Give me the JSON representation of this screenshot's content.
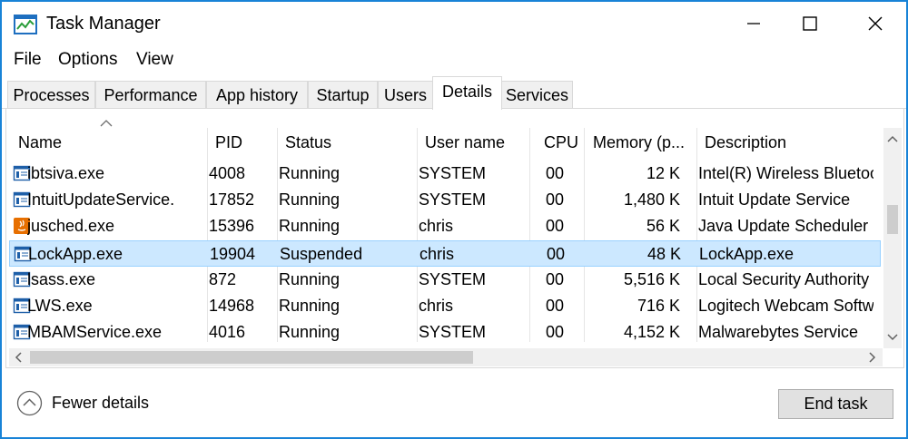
{
  "window": {
    "title": "Task Manager"
  },
  "menu": [
    "File",
    "Options",
    "View"
  ],
  "tabs": [
    {
      "label": "Processes",
      "active": false
    },
    {
      "label": "Performance",
      "active": false
    },
    {
      "label": "App history",
      "active": false
    },
    {
      "label": "Startup",
      "active": false
    },
    {
      "label": "Users",
      "active": false
    },
    {
      "label": "Details",
      "active": true
    },
    {
      "label": "Services",
      "active": false
    }
  ],
  "columns": [
    "Name",
    "PID",
    "Status",
    "User name",
    "CPU",
    "Memory (p...",
    "Description"
  ],
  "rows": [
    {
      "icon": "generic-app-icon",
      "name": "ibtsiva.exe",
      "pid": "4008",
      "status": "Running",
      "user": "SYSTEM",
      "cpu": "00",
      "memory": "12 K",
      "description": "Intel(R) Wireless Bluetoo",
      "selected": false
    },
    {
      "icon": "generic-app-icon",
      "name": "IntuitUpdateService.",
      "pid": "17852",
      "status": "Running",
      "user": "SYSTEM",
      "cpu": "00",
      "memory": "1,480 K",
      "description": "Intuit Update Service",
      "selected": false
    },
    {
      "icon": "java-icon",
      "name": "jusched.exe",
      "pid": "15396",
      "status": "Running",
      "user": "chris",
      "cpu": "00",
      "memory": "56 K",
      "description": "Java Update Scheduler",
      "selected": false
    },
    {
      "icon": "generic-app-icon",
      "name": "LockApp.exe",
      "pid": "19904",
      "status": "Suspended",
      "user": "chris",
      "cpu": "00",
      "memory": "48 K",
      "description": "LockApp.exe",
      "selected": true
    },
    {
      "icon": "generic-app-icon",
      "name": "lsass.exe",
      "pid": "872",
      "status": "Running",
      "user": "SYSTEM",
      "cpu": "00",
      "memory": "5,516 K",
      "description": "Local Security Authority",
      "selected": false
    },
    {
      "icon": "generic-app-icon",
      "name": "LWS.exe",
      "pid": "14968",
      "status": "Running",
      "user": "chris",
      "cpu": "00",
      "memory": "716 K",
      "description": "Logitech Webcam Softw",
      "selected": false
    },
    {
      "icon": "generic-app-icon",
      "name": "MBAMService.exe",
      "pid": "4016",
      "status": "Running",
      "user": "SYSTEM",
      "cpu": "00",
      "memory": "4,152 K",
      "description": "Malwarebytes Service",
      "selected": false
    }
  ],
  "footer": {
    "fewer_details": "Fewer details",
    "end_task": "End task"
  },
  "colors": {
    "window_border": "#1883d7",
    "selection": "#cce8ff",
    "selection_border": "#99d1ff",
    "java_orange": "#e76f00"
  }
}
